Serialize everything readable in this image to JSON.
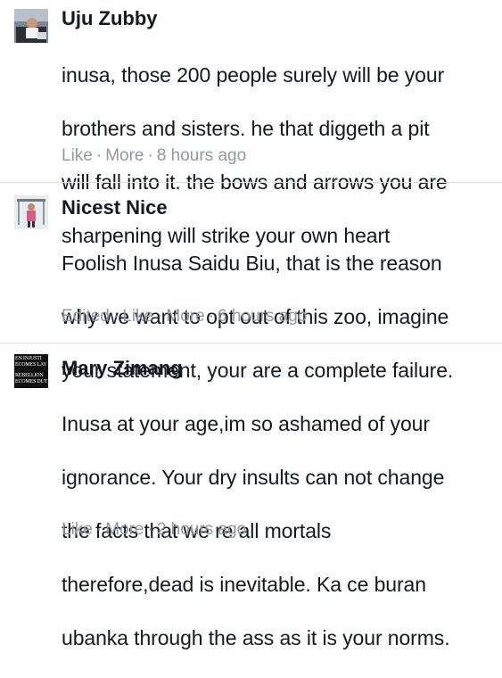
{
  "comments": [
    {
      "name": "Uju Zubby",
      "lines": [
        "inusa, those 200 people surely will be your",
        "brothers and sisters. he that diggeth a pit",
        "will fall into it. the bows and arrows you are",
        "sharpening will strike your own heart"
      ],
      "actions": [
        "Like",
        "More"
      ],
      "time": "8 hours ago"
    },
    {
      "name": "Nicest Nice",
      "lines": [
        "Foolish Inusa Saidu Biu, that is the reason",
        "why we want to opt out of this zoo, imagine",
        "your statement, your are a complete failure."
      ],
      "edited": "Edited",
      "actions": [
        "Like",
        "More"
      ],
      "time": "6 hours ago"
    },
    {
      "name": "Mary Zimang",
      "avatar_text": [
        "EN INJUSTI",
        "ECOMES LAV",
        "REBELLION",
        "ECOMES DUT"
      ],
      "lines": [
        "Inusa at your age,im so ashamed of your",
        "ignorance. Your dry insults can not change",
        "the facts that we re all mortals",
        "therefore,dead is inevitable. Ka ce buran",
        "ubanka through the ass as it is your norms."
      ],
      "actions": [
        "Like",
        "More"
      ],
      "time": "2 hours ago"
    }
  ]
}
